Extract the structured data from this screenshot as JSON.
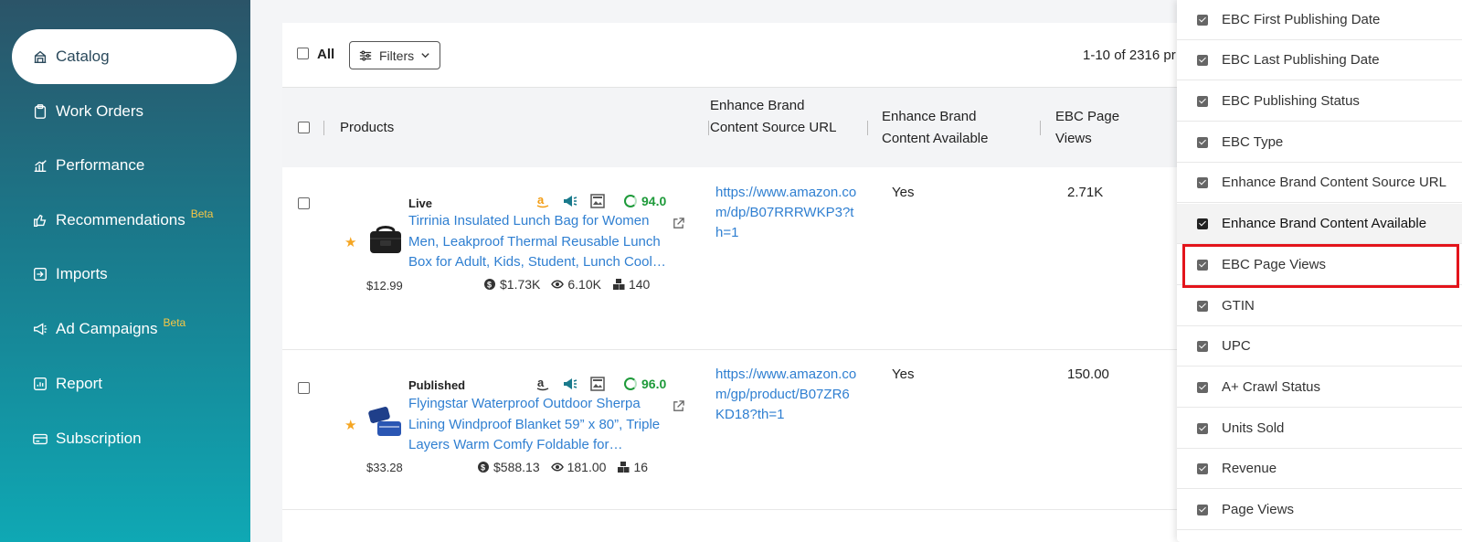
{
  "sidebar": {
    "items": [
      {
        "label": "Catalog",
        "icon": "catalog-icon",
        "active": true
      },
      {
        "label": "Work Orders",
        "icon": "clipboard-icon"
      },
      {
        "label": "Performance",
        "icon": "bar-chart-icon"
      },
      {
        "label": "Recommendations",
        "icon": "thumbs-up-icon",
        "badge": "Beta"
      },
      {
        "label": "Imports",
        "icon": "import-icon"
      },
      {
        "label": "Ad Campaigns",
        "icon": "megaphone-icon",
        "badge": "Beta"
      },
      {
        "label": "Report",
        "icon": "report-icon"
      },
      {
        "label": "Subscription",
        "icon": "card-icon"
      }
    ]
  },
  "toolbar": {
    "all_label": "All",
    "filters_label": "Filters",
    "pagination": "1-10 of 2316 pr"
  },
  "table": {
    "headers": {
      "products": "Products",
      "ebc_source_url": "Enhance Brand Content Source URL",
      "ebc_available": "Enhance Brand Content Available",
      "ebc_page_views": "EBC Page Views"
    },
    "rows": [
      {
        "status": "Live",
        "score": "94.0",
        "title": "Tirrinia Insulated Lunch Bag for Women Men, Leakproof Thermal Reusable Lunch Box for Adult, Kids, Student, Lunch Cooler Bag",
        "price": "$12.99",
        "revenue": "$1.73K",
        "views": "6.10K",
        "units": "140",
        "url": "https://www.amazon.com/dp/B07RRRWKP3?th=1",
        "available": "Yes",
        "page_views": "2.71K"
      },
      {
        "status": "Published",
        "score": "96.0",
        "title": "Flyingstar Waterproof Outdoor Sherpa Lining Windproof Blanket 59” x 80”, Triple Layers Warm Comfy Foldable for Camping",
        "price": "$33.28",
        "revenue": "$588.13",
        "views": "181.00",
        "units": "16",
        "url": "https://www.amazon.com/gp/product/B07ZR6KD18?th=1",
        "available": "Yes",
        "page_views": "150.00"
      }
    ]
  },
  "column_panel": {
    "options": [
      {
        "label": "EBC First Publishing Date"
      },
      {
        "label": "EBC Last Publishing Date"
      },
      {
        "label": "EBC Publishing Status"
      },
      {
        "label": "EBC Type"
      },
      {
        "label": "Enhance Brand Content Source URL"
      },
      {
        "label": "Enhance Brand Content Available",
        "hovered": true
      },
      {
        "label": "EBC Page Views",
        "highlighted": true
      },
      {
        "label": "GTIN"
      },
      {
        "label": "UPC"
      },
      {
        "label": "A+ Crawl Status"
      },
      {
        "label": "Units Sold"
      },
      {
        "label": "Revenue"
      },
      {
        "label": "Page Views"
      }
    ]
  },
  "colors": {
    "sidebar_top": "#2b5468",
    "sidebar_bottom": "#0fa8b4",
    "link": "#2f7fd1",
    "score_green": "#1e9a3a",
    "star": "#f5a623",
    "beta": "#f7c744",
    "highlight_box": "#e3141b"
  }
}
